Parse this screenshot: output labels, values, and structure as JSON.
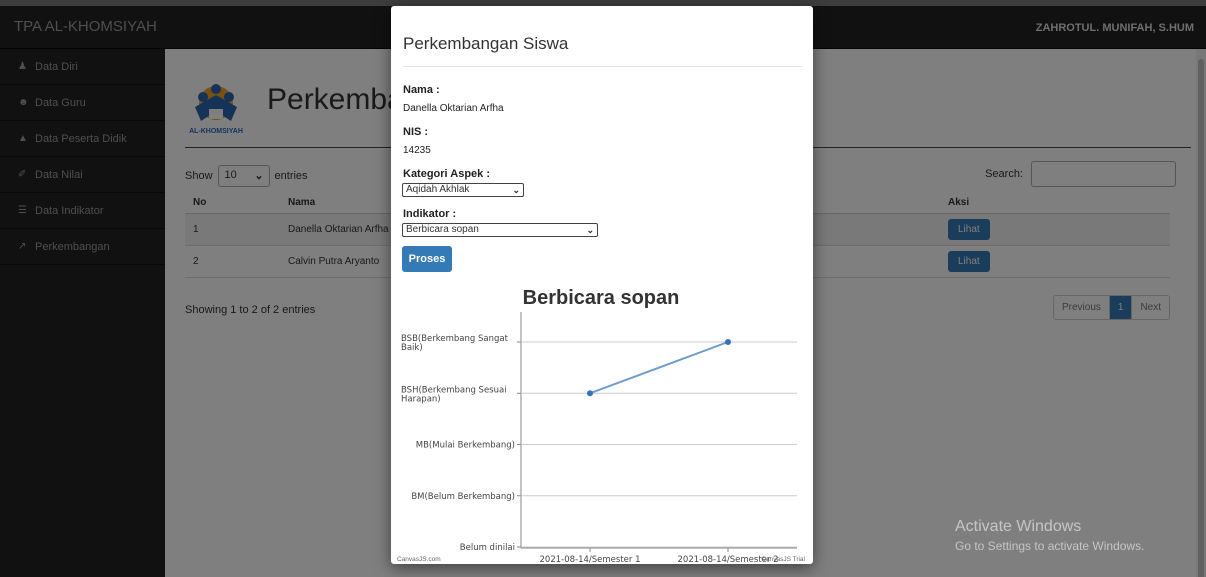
{
  "app": {
    "brand": "TPA AL-KHOMSIYAH",
    "user": "ZAHROTUL. MUNIFAH, S.HUM",
    "logo_text": "AL-KHOMSIYAH"
  },
  "sidebar": {
    "items": [
      {
        "label": "Data Diri",
        "icon": "user-icon"
      },
      {
        "label": "Data Guru",
        "icon": "users-icon"
      },
      {
        "label": "Data Peserta Didik",
        "icon": "graduation-cap-icon"
      },
      {
        "label": "Data Nilai",
        "icon": "edit-icon"
      },
      {
        "label": "Data Indikator",
        "icon": "list-icon"
      },
      {
        "label": "Perkembangan",
        "icon": "line-chart-icon"
      }
    ]
  },
  "page": {
    "title": "Perkembangan",
    "show_label": "Show",
    "entries_value": "10",
    "entries_label": "entries",
    "search_label": "Search:",
    "columns": [
      "No",
      "Nama",
      "",
      "Aksi"
    ],
    "rows": [
      {
        "no": "1",
        "nama": "Danella Oktarian Arfha",
        "aksi": "Lihat"
      },
      {
        "no": "2",
        "nama": "Calvin Putra Aryanto",
        "aksi": "Lihat"
      }
    ],
    "info": "Showing 1 to 2 of 2 entries",
    "pagination": {
      "previous": "Previous",
      "current": "1",
      "next": "Next"
    }
  },
  "modal": {
    "title": "Perkembangan Siswa",
    "nama_label": "Nama :",
    "nama_value": "Danella Oktarian Arfha",
    "nis_label": "NIS :",
    "nis_value": "14235",
    "kategori_label": "Kategori Aspek :",
    "kategori_value": "Aqidah Akhlak",
    "indikator_label": "Indikator :",
    "indikator_value": "Berbicara sopan",
    "proses_label": "Proses"
  },
  "chart_data": {
    "type": "line",
    "title": "Berbicara sopan",
    "categories": [
      "2021-08-14/Semester 1",
      "2021-08-14/Semester 2"
    ],
    "y_categories": [
      "Belum dinilai",
      "BM(Belum Berkembang)",
      "MB(Mulai Berkembang)",
      "BSH(Berkembang Sesuai Harapan)",
      "BSB(Berkembang Sangat Baik)"
    ],
    "series": [
      {
        "values": [
          3,
          4
        ],
        "color": "#6d9ccf"
      }
    ],
    "ylim": [
      0,
      4
    ],
    "grid": true,
    "credit_left": "CanvasJS.com",
    "credit_right": "CanvasJS Trial"
  },
  "watermark": {
    "line1": "Activate Windows",
    "line2": "Go to Settings to activate Windows."
  },
  "colors": {
    "primary": "#337ab7",
    "navbar": "#222222",
    "line": "#6d9ccf"
  }
}
